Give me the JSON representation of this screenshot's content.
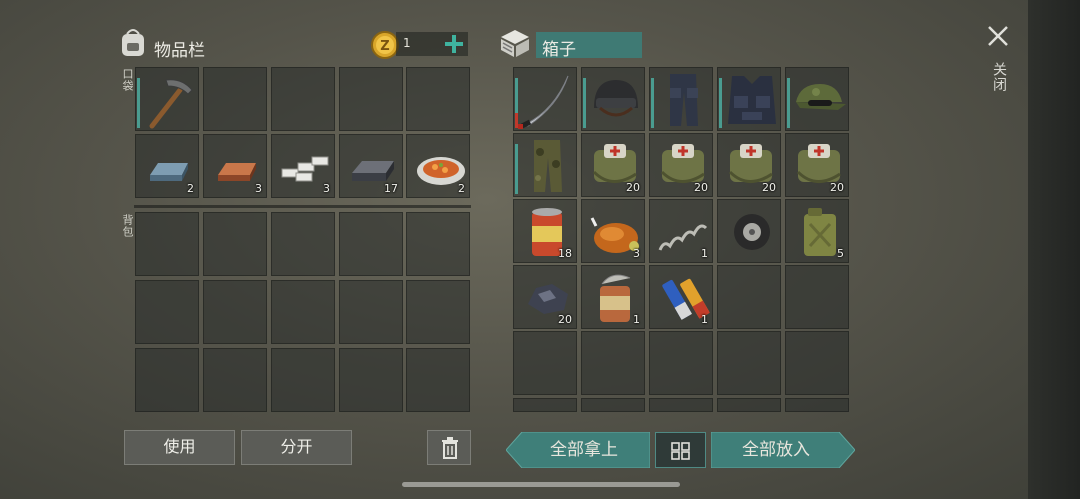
{
  "inventory": {
    "title": "物品栏",
    "coins": "1",
    "pocket_label": "口袋",
    "backpack_label": "背包",
    "pocket_items": [
      {
        "name": "pickaxe",
        "qty": ""
      },
      {
        "name": "",
        "qty": ""
      },
      {
        "name": "",
        "qty": ""
      },
      {
        "name": "",
        "qty": ""
      },
      {
        "name": "",
        "qty": ""
      },
      {
        "name": "iron-ingot",
        "qty": "2"
      },
      {
        "name": "copper-ingot",
        "qty": "3"
      },
      {
        "name": "aluminum-ingots",
        "qty": "3"
      },
      {
        "name": "steel-ingot",
        "qty": "17"
      },
      {
        "name": "cooked-dish",
        "qty": "2"
      }
    ],
    "use_button": "使用",
    "split_button": "分开"
  },
  "container": {
    "title": "箱子",
    "items": [
      {
        "name": "katana",
        "qty": ""
      },
      {
        "name": "combat-helmet",
        "qty": ""
      },
      {
        "name": "armored-pants",
        "qty": ""
      },
      {
        "name": "tactical-vest",
        "qty": ""
      },
      {
        "name": "camo-cap",
        "qty": ""
      },
      {
        "name": "camo-pants",
        "qty": ""
      },
      {
        "name": "medkit-bag",
        "qty": "20"
      },
      {
        "name": "medkit-bag",
        "qty": "20"
      },
      {
        "name": "medkit-bag",
        "qty": "20"
      },
      {
        "name": "medkit-bag",
        "qty": "20"
      },
      {
        "name": "canned-food",
        "qty": "18"
      },
      {
        "name": "roast-chicken",
        "qty": "3"
      },
      {
        "name": "spring",
        "qty": "1"
      },
      {
        "name": "tire",
        "qty": ""
      },
      {
        "name": "jerry-can",
        "qty": "5"
      },
      {
        "name": "coal-ore",
        "qty": "20"
      },
      {
        "name": "opened-can",
        "qty": "1"
      },
      {
        "name": "batteries",
        "qty": "1"
      }
    ],
    "take_all": "全部拿上",
    "put_all": "全部放入"
  },
  "close_label": "关闭",
  "colors": {
    "accent": "#3f7f79",
    "durability": "#4a9c90",
    "plus": "#3fb39f"
  }
}
